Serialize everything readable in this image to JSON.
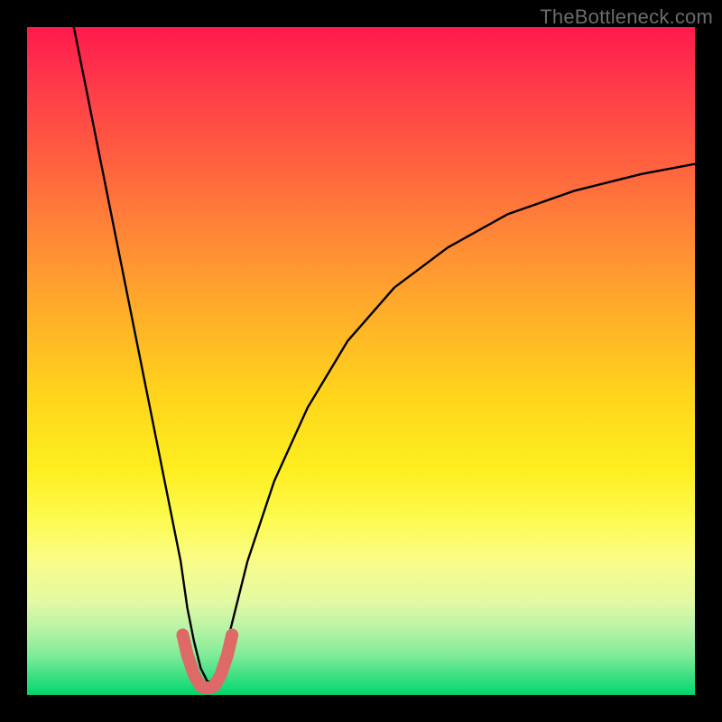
{
  "watermark": "TheBottleneck.com",
  "chart_data": {
    "type": "line",
    "title": "",
    "xlabel": "",
    "ylabel": "",
    "xlim": [
      0,
      100
    ],
    "ylim": [
      0,
      100
    ],
    "series": [
      {
        "name": "bottleneck-curve",
        "x": [
          7,
          9,
          11,
          13,
          15,
          17,
          19,
          21,
          23,
          24,
          25,
          26,
          27,
          28,
          29,
          30,
          33,
          37,
          42,
          48,
          55,
          63,
          72,
          82,
          92,
          100
        ],
        "values": [
          100,
          90,
          80,
          70,
          60,
          50,
          40,
          30,
          20,
          13,
          8,
          4,
          2,
          2,
          4,
          8,
          20,
          32,
          43,
          53,
          61,
          67,
          72,
          75.5,
          78,
          79.5
        ]
      },
      {
        "name": "highlight-segment",
        "x": [
          23.3,
          24,
          25,
          26,
          27,
          28,
          29,
          30,
          30.7
        ],
        "values": [
          9,
          6,
          3,
          1.3,
          1,
          1.3,
          3,
          6,
          9
        ]
      }
    ],
    "colors": {
      "curve": "#000000",
      "highlight": "#dd6a66",
      "gradient_top": "#ff1a4d",
      "gradient_bottom": "#00d56e"
    }
  }
}
